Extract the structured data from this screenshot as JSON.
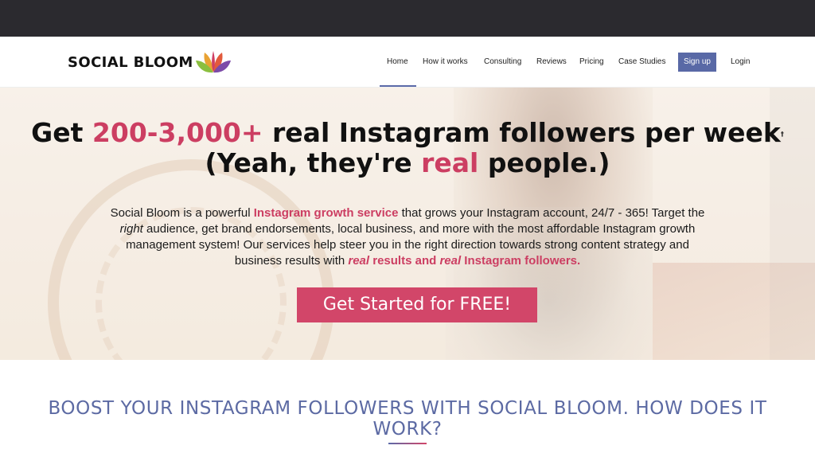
{
  "logo": {
    "text": "SOCIAL BLOOM",
    "icon": "lotus-flower-logo"
  },
  "nav": {
    "items": [
      {
        "label": "Home",
        "active": true
      },
      {
        "label": "How it works"
      },
      {
        "label": "Consulting"
      },
      {
        "label": "Reviews"
      },
      {
        "label": "Pricing"
      },
      {
        "label": "Case Studies"
      }
    ],
    "signup": "Sign up",
    "login": "Login"
  },
  "hero": {
    "line1_a": "Get ",
    "line1_accent": "200-3,000+",
    "line1_b": " real Instagram followers per week",
    "dagger": "†",
    "line2_a": "(Yeah, they're ",
    "line2_accent": "real",
    "line2_b": " people.)",
    "desc": {
      "p1": "Social Bloom is a powerful ",
      "p1_link": "Instagram growth service",
      "p2": " that grows your Instagram account, 24/7 - 365! Target the ",
      "p2_em": "right",
      "p3": " audience, get brand endorsements, local business, and more with the most affordable Instagram growth management system! Our services help steer you in the right direction towards strong content strategy and business results with ",
      "p3_em1": "real",
      "p3_mid": " results and ",
      "p3_em2": "real",
      "p3_end": " Instagram followers."
    },
    "cta": "Get Started for FREE!"
  },
  "section": {
    "title": "BOOST YOUR INSTAGRAM FOLLOWERS WITH SOCIAL BLOOM. HOW DOES IT WORK?"
  },
  "colors": {
    "accent_pink": "#cc3e62",
    "accent_blue": "#5c6aa3",
    "topbar": "#2b2a2f"
  }
}
